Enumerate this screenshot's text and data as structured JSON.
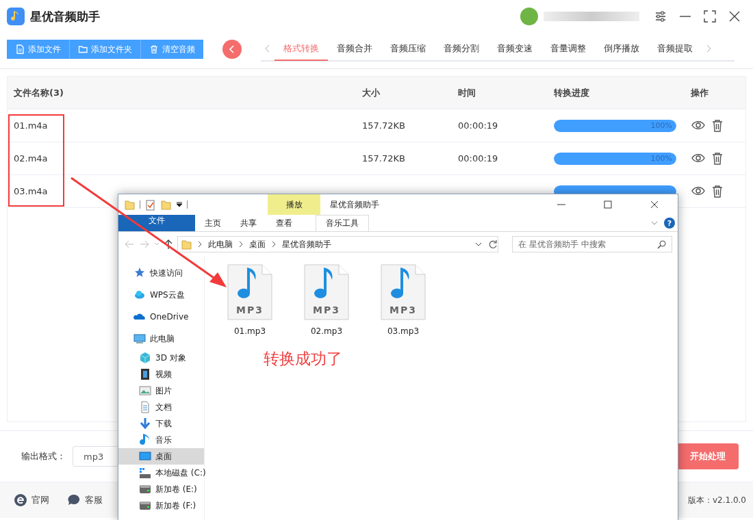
{
  "app": {
    "title": "星优音频助手"
  },
  "toolbar": [
    {
      "label": "添加文件",
      "kind": "file"
    },
    {
      "label": "添加文件夹",
      "kind": "folder"
    },
    {
      "label": "清空音频",
      "kind": "trash"
    }
  ],
  "tabs": [
    {
      "label": "格式转换",
      "selected": true
    },
    {
      "label": "音频合并",
      "selected": false
    },
    {
      "label": "音频压缩",
      "selected": false
    },
    {
      "label": "音频分割",
      "selected": false
    },
    {
      "label": "音频变速",
      "selected": false
    },
    {
      "label": "音量调整",
      "selected": false
    },
    {
      "label": "倒序播放",
      "selected": false
    },
    {
      "label": "音频提取",
      "selected": false
    }
  ],
  "table": {
    "columns": [
      "文件名称(3)",
      "大小",
      "时间",
      "转换进度",
      "操作"
    ],
    "rows": [
      {
        "name": "01.m4a",
        "size": "157.72KB",
        "time": "00:00:19",
        "level": 1,
        "reading": "100%"
      },
      {
        "name": "02.m4a",
        "size": "157.72KB",
        "time": "00:00:19",
        "level": 1,
        "reading": "100%"
      },
      {
        "name": "03.m4a",
        "level": 1
      }
    ]
  },
  "output": {
    "label": "输出格式：",
    "value": "mp3"
  },
  "start_button": "开始处理",
  "footer": {
    "links": [
      {
        "label": "官网",
        "kind": "browser"
      },
      {
        "label": "客服",
        "kind": "chat"
      }
    ],
    "version": "版本：v2.1.0.0"
  },
  "explorer": {
    "title": "星优音频助手",
    "context_tab": "播放",
    "ribbon_tabs": [
      {
        "label": "文件",
        "kind": "file"
      },
      {
        "label": "主页",
        "kind": "plain"
      },
      {
        "label": "共享",
        "kind": "plain"
      },
      {
        "label": "查看",
        "kind": "plain"
      },
      {
        "label": "音乐工具",
        "kind": "context"
      }
    ],
    "path": [
      "此电脑",
      "桌面",
      "星优音频助手"
    ],
    "search": {
      "placeholder": "在 星优音频助手 中搜索"
    },
    "nav": [
      {
        "label": "快速访问",
        "kind": "star",
        "selected": false
      },
      {
        "label": "WPS云盘",
        "kind": "cloud",
        "selected": false
      },
      {
        "label": "OneDrive",
        "kind": "onedrive",
        "selected": false
      },
      {
        "label": "此电脑",
        "kind": "pc",
        "selected": false,
        "children": [
          {
            "label": "3D 对象",
            "kind": "cube",
            "selected": false
          },
          {
            "label": "视频",
            "kind": "video",
            "selected": false
          },
          {
            "label": "图片",
            "kind": "picture",
            "selected": false
          },
          {
            "label": "文档",
            "kind": "doc",
            "selected": false
          },
          {
            "label": "下载",
            "kind": "download",
            "selected": false
          },
          {
            "label": "音乐",
            "kind": "music",
            "selected": false
          },
          {
            "label": "桌面",
            "kind": "desktop",
            "selected": true
          },
          {
            "label": "本地磁盘 (C:)",
            "kind": "disk",
            "selected": false
          },
          {
            "label": "新加卷 (E:)",
            "kind": "drive",
            "selected": false
          },
          {
            "label": "新加卷 (F:)",
            "kind": "drive",
            "selected": false
          }
        ]
      }
    ],
    "help": "?",
    "files": [
      {
        "name": "01.mp3",
        "badge": "MP3"
      },
      {
        "name": "02.mp3",
        "badge": "MP3"
      },
      {
        "name": "03.mp3",
        "badge": "MP3"
      }
    ]
  },
  "annotation": "转换成功了"
}
